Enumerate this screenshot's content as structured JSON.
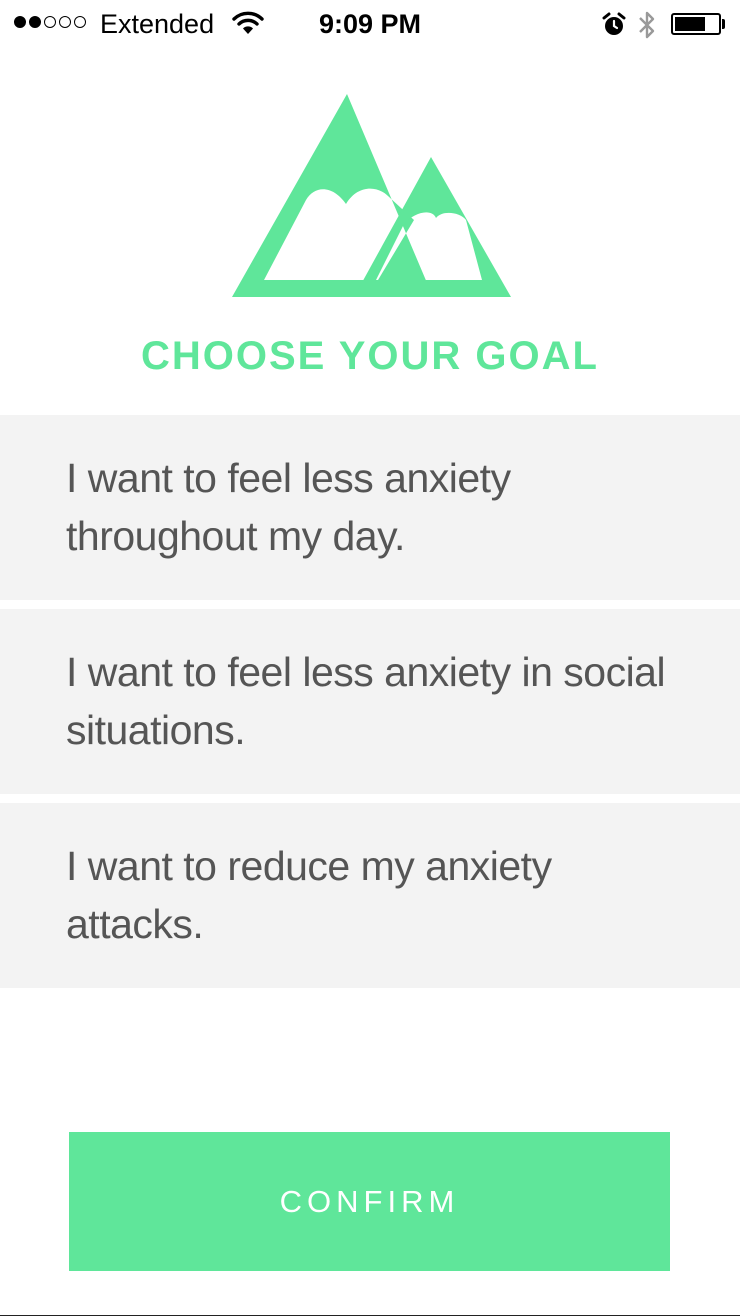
{
  "status_bar": {
    "carrier": "Extended",
    "time": "9:09 PM",
    "signal_bars_filled": 2,
    "signal_bars_total": 5,
    "battery_level": 0.72,
    "icons": [
      "wifi-icon",
      "alarm-icon",
      "bluetooth-icon",
      "battery-icon"
    ]
  },
  "header": {
    "logo": "mountains-icon",
    "title": "CHOOSE YOUR GOAL"
  },
  "goals": [
    {
      "label": "I want to feel less anxiety throughout my day."
    },
    {
      "label": "I want to feel less anxiety in social situations."
    },
    {
      "label": "I want to reduce my anxiety attacks."
    }
  ],
  "confirm": {
    "label": "CONFIRM"
  },
  "colors": {
    "accent": "#5fe69a",
    "option_background": "#f3f3f3",
    "option_text": "#555555",
    "button_text": "#ffffff"
  }
}
